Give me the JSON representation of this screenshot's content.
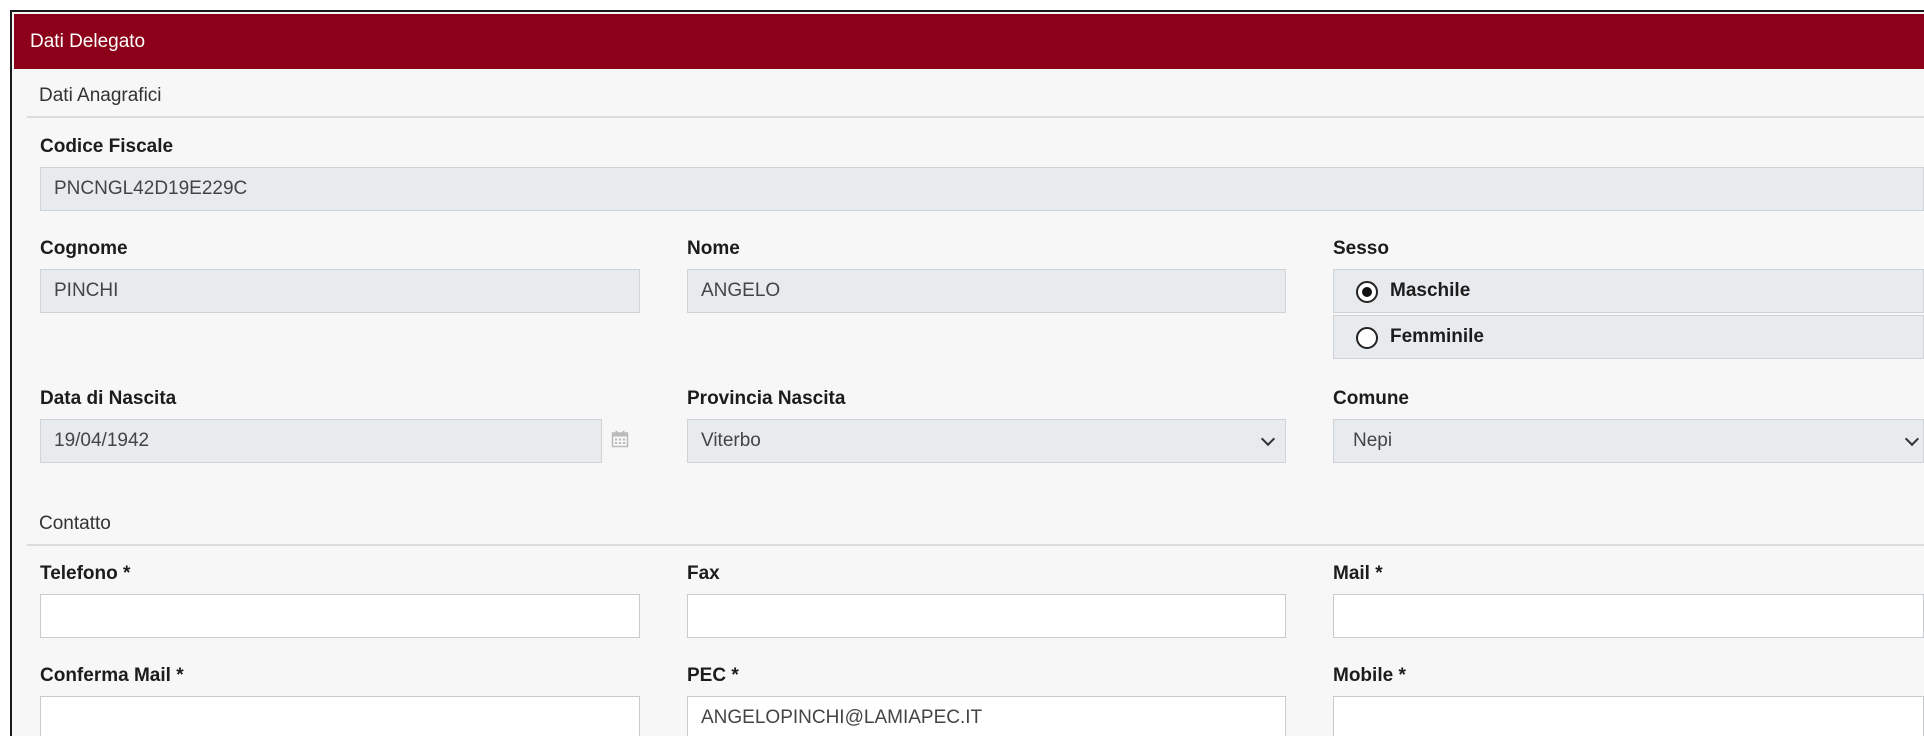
{
  "panel": {
    "title": "Dati Delegato"
  },
  "sections": {
    "anagrafica": "Dati Anagrafici",
    "contatto": "Contatto"
  },
  "fields": {
    "codice_fiscale": {
      "label": "Codice Fiscale",
      "value": "PNCNGL42D19E229C"
    },
    "cognome": {
      "label": "Cognome",
      "value": "PINCHI"
    },
    "nome": {
      "label": "Nome",
      "value": "ANGELO"
    },
    "sesso": {
      "label": "Sesso",
      "options": [
        "Maschile",
        "Femminile"
      ],
      "selected": "Maschile"
    },
    "data_nascita": {
      "label": "Data di Nascita",
      "value": "19/04/1942"
    },
    "provincia_nascita": {
      "label": "Provincia Nascita",
      "value": "Viterbo"
    },
    "comune": {
      "label": "Comune",
      "value": "Nepi"
    },
    "telefono": {
      "label": "Telefono *",
      "value": ""
    },
    "fax": {
      "label": "Fax",
      "value": ""
    },
    "mail": {
      "label": "Mail *",
      "value": ""
    },
    "conferma_mail": {
      "label": "Conferma Mail *",
      "value": ""
    },
    "pec": {
      "label": "PEC *",
      "value": "ANGELOPINCHI@LAMIAPEC.IT"
    },
    "mobile": {
      "label": "Mobile *",
      "value": ""
    }
  },
  "icons": {
    "calendar": "calendar-icon",
    "dropdown": "chevron-down-icon"
  },
  "colors": {
    "header_bg": "#8c0019",
    "readonly_bg": "#e8ebee",
    "page_bg": "#f7f7f7"
  }
}
